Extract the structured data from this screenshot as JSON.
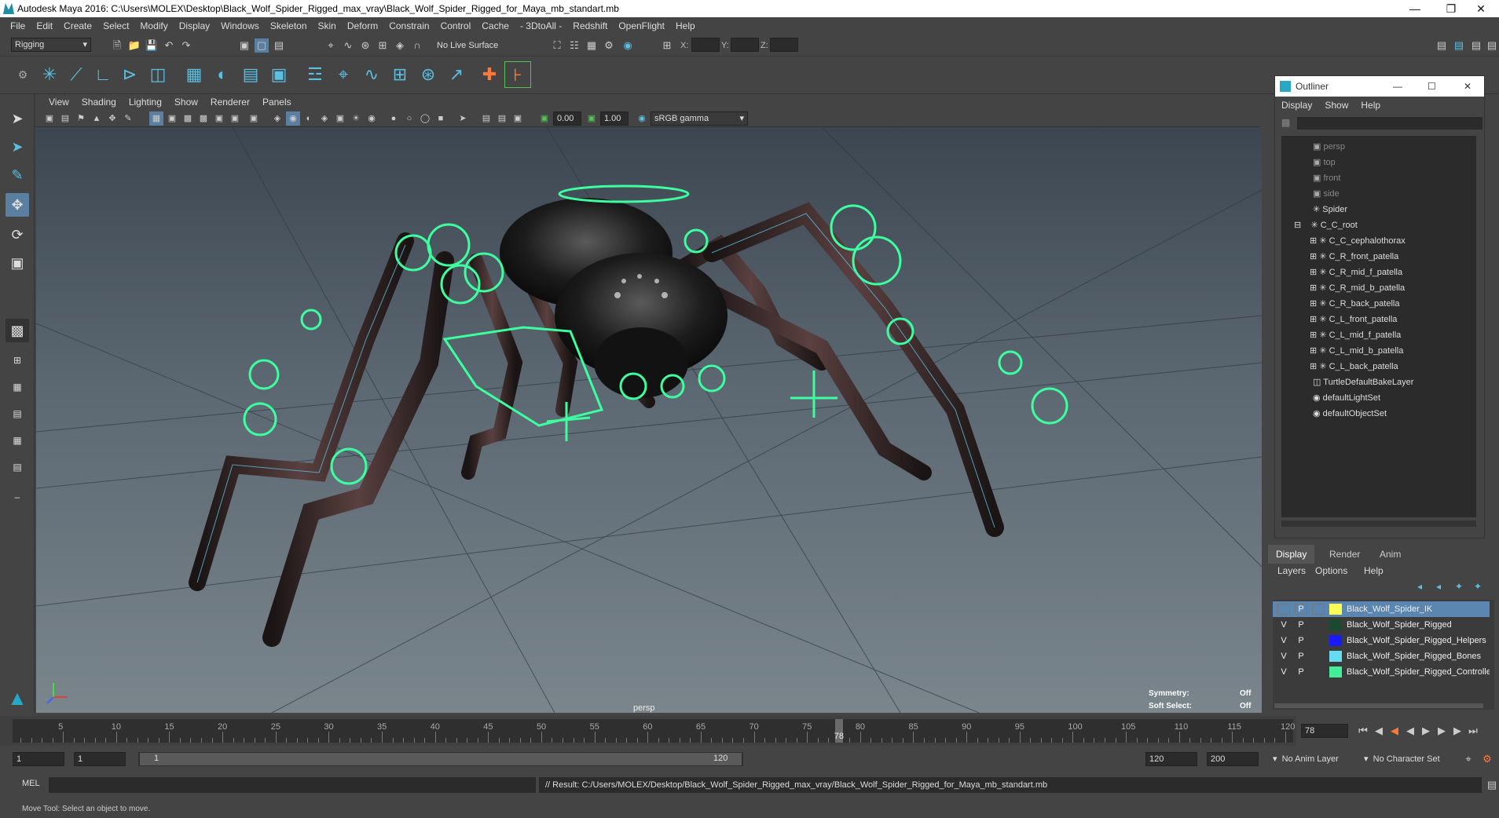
{
  "title_bar": {
    "text": "Autodesk Maya 2016: C:\\Users\\MOLEX\\Desktop\\Black_Wolf_Spider_Rigged_max_vray\\Black_Wolf_Spider_Rigged_for_Maya_mb_standart.mb"
  },
  "menu": [
    "File",
    "Edit",
    "Create",
    "Select",
    "Modify",
    "Display",
    "Windows",
    "Skeleton",
    "Skin",
    "Deform",
    "Constrain",
    "Control",
    "Cache",
    "- 3DtoAll -",
    "Redshift",
    "OpenFlight",
    "Help"
  ],
  "status_line": {
    "menuset": "Rigging",
    "live_surface": "No Live Surface",
    "x_label": "X:",
    "y_label": "Y:",
    "z_label": "Z:"
  },
  "viewport_menu": [
    "View",
    "Shading",
    "Lighting",
    "Show",
    "Renderer",
    "Panels"
  ],
  "viewport_toolbar": {
    "exposure": "0.00",
    "gamma": "1.00",
    "color_space": "sRGB gamma"
  },
  "viewport": {
    "camera_label": "persp",
    "symmetry_label": "Symmetry:",
    "symmetry_value": "Off",
    "soft_select_label": "Soft Select:",
    "soft_select_value": "Off"
  },
  "outliner": {
    "title": "Outliner",
    "menu": [
      "Display",
      "Show",
      "Help"
    ],
    "items": [
      {
        "label": "persp",
        "type": "camera",
        "dim": true
      },
      {
        "label": "top",
        "type": "camera",
        "dim": true
      },
      {
        "label": "front",
        "type": "camera",
        "dim": true
      },
      {
        "label": "side",
        "type": "camera",
        "dim": true
      },
      {
        "label": "Spider",
        "type": "joint",
        "dim": false
      },
      {
        "label": "C_C_root",
        "type": "joint",
        "dim": false
      },
      {
        "label": "C_C_cephalothorax",
        "type": "joint",
        "dim": false
      },
      {
        "label": "C_R_front_patella",
        "type": "joint",
        "dim": false
      },
      {
        "label": "C_R_mid_f_patella",
        "type": "joint",
        "dim": false
      },
      {
        "label": "C_R_mid_b_patella",
        "type": "joint",
        "dim": false
      },
      {
        "label": "C_R_back_patella",
        "type": "joint",
        "dim": false
      },
      {
        "label": "C_L_front_patella",
        "type": "joint",
        "dim": false
      },
      {
        "label": "C_L_mid_f_patella",
        "type": "joint",
        "dim": false
      },
      {
        "label": "C_L_mid_b_patella",
        "type": "joint",
        "dim": false
      },
      {
        "label": "C_L_back_patella",
        "type": "joint",
        "dim": false
      },
      {
        "label": "TurtleDefaultBakeLayer",
        "type": "set",
        "dim": false
      },
      {
        "label": "defaultLightSet",
        "type": "set",
        "dim": false
      },
      {
        "label": "defaultObjectSet",
        "type": "set",
        "dim": false
      }
    ]
  },
  "layer_editor": {
    "tabs": [
      "Display",
      "Render",
      "Anim"
    ],
    "menu": [
      "Layers",
      "Options",
      "Help"
    ],
    "layers": [
      {
        "v": "",
        "p": "P",
        "name": "Black_Wolf_Spider_IK",
        "color": "#ffff55",
        "selected": true
      },
      {
        "v": "V",
        "p": "P",
        "name": "Black_Wolf_Spider_Rigged",
        "color": "#1c4a2e",
        "selected": false
      },
      {
        "v": "V",
        "p": "P",
        "name": "Black_Wolf_Spider_Rigged_Helpers",
        "color": "#1a1aff",
        "selected": false
      },
      {
        "v": "V",
        "p": "P",
        "name": "Black_Wolf_Spider_Rigged_Bones",
        "color": "#66ddee",
        "selected": false
      },
      {
        "v": "V",
        "p": "P",
        "name": "Black_Wolf_Spider_Rigged_Controllers",
        "color": "#44ee99",
        "selected": false
      }
    ]
  },
  "time_slider": {
    "ticks": [
      "5",
      "10",
      "15",
      "20",
      "25",
      "30",
      "35",
      "40",
      "45",
      "50",
      "55",
      "60",
      "65",
      "70",
      "75",
      "80",
      "85",
      "90",
      "95",
      "100",
      "105",
      "110",
      "115",
      "120"
    ],
    "current_frame": "78",
    "current_field": "78"
  },
  "range_slider": {
    "start": "1",
    "playback_start": "1",
    "range_start_label": "1",
    "range_end_label": "120",
    "playback_end": "120",
    "end": "200",
    "anim_layer": "No Anim Layer",
    "character_set": "No Character Set"
  },
  "command_line": {
    "lang": "MEL",
    "result": "// Result: C:/Users/MOLEX/Desktop/Black_Wolf_Spider_Rigged_max_vray/Black_Wolf_Spider_Rigged_for_Maya_mb_standart.mb"
  },
  "help_line": "Move Tool: Select an object to move.",
  "colors": {
    "controller": "#3dffa0",
    "accent": "#5abfe0"
  }
}
